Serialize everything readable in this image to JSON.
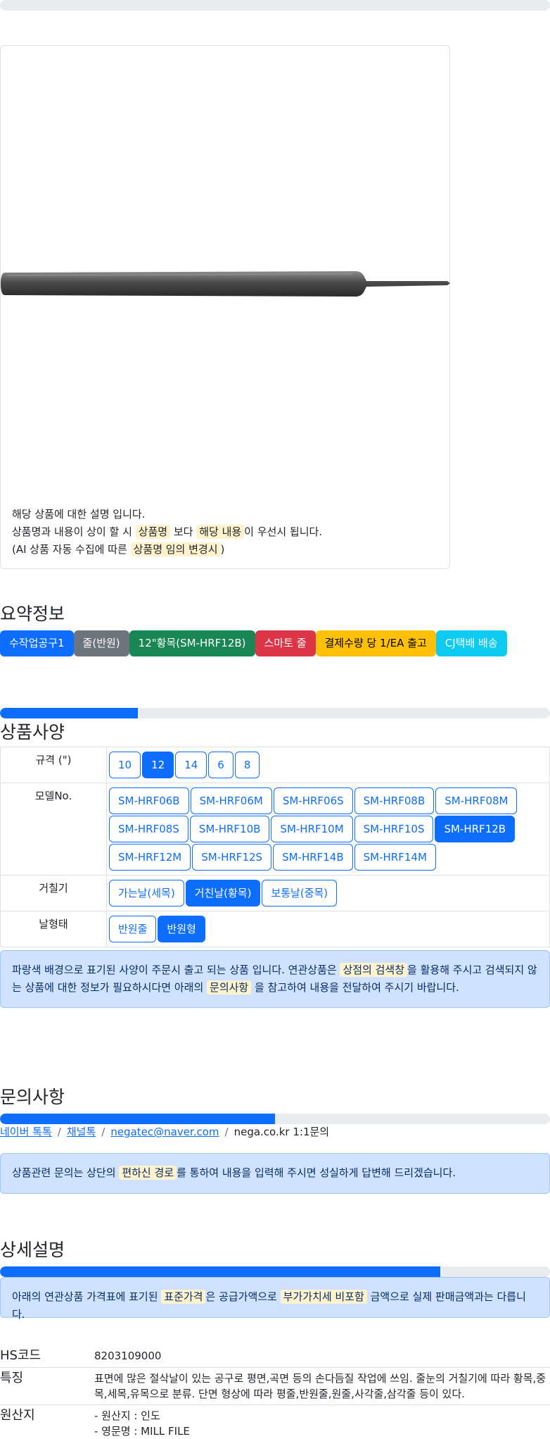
{
  "product": {
    "notice_line1": "해당 상품에 대한 설명 입니다.",
    "notice_line2_a": "상품명과 내용이 상이 할 시 ",
    "notice_line2_b": "상품명",
    "notice_line2_c": " 보다 ",
    "notice_line2_d": "해당 내용",
    "notice_line2_e": "이 우선시 됩니다.",
    "notice_line3_a": "(AI 상품 자동 수집에 따른 ",
    "notice_line3_b": "상품명 임의 변경시",
    "notice_line3_c": ")"
  },
  "summary": {
    "title": "요약정보",
    "badges": [
      {
        "label": "수작업공구1",
        "color": "#0d6efd"
      },
      {
        "label": "줄(반원)",
        "color": "#6c757d"
      },
      {
        "label": "12\"황목(SM-HRF12B)",
        "color": "#198754"
      },
      {
        "label": "스마토 줄",
        "color": "#dc3545"
      },
      {
        "label": "결제수량 당 1/EA 출고",
        "color": "#ffc107"
      },
      {
        "label": "CJ택배 배송",
        "color": "#0dcaf0"
      }
    ]
  },
  "spec": {
    "progress": 0.25,
    "title": "상품사양",
    "rows": [
      {
        "label": "규격 (\")",
        "options": [
          "10",
          "12",
          "14",
          "6",
          "8"
        ],
        "selected": 1
      },
      {
        "label": "모델No.",
        "options": [
          "SM-HRF06B",
          "SM-HRF06M",
          "SM-HRF06S",
          "SM-HRF08B",
          "SM-HRF08M",
          "SM-HRF08S",
          "SM-HRF10B",
          "SM-HRF10M",
          "SM-HRF10S",
          "SM-HRF12B",
          "SM-HRF12M",
          "SM-HRF12S",
          "SM-HRF14B",
          "SM-HRF14M"
        ],
        "selected": 9
      },
      {
        "label": "거칠기",
        "options": [
          "가는날(세목)",
          "거친날(황목)",
          "보통날(중목)"
        ],
        "selected": 1
      },
      {
        "label": "날형태",
        "options": [
          "반원줄",
          "반원형"
        ],
        "selected": 1
      }
    ],
    "notice_a": "파랑색 배경으로 표기된 사양이 주문시 출고 되는 상품 입니다. 연관상품은 ",
    "notice_b": "상점의 검색창",
    "notice_c": "을 활용해 주시고 검색되지 않는 상품에 대한 정보가 필요하시다면 아래의 ",
    "notice_d": "문의사항",
    "notice_e": " 을 참고하여 내용을 전달하여 주시기 바랍니다."
  },
  "inquiry": {
    "title": "문의사항",
    "progress": 0.5,
    "links": [
      "네이버 톡톡",
      "채널톡",
      "negatec@naver.com"
    ],
    "plain": "nega.co.kr 1:1문의",
    "sep": "/",
    "notice_a": "상품관련 문의는 상단의 ",
    "notice_b": "편하신 경로",
    "notice_c": "를 통하여 내용을 입력해 주시면 성실하게 답변해 드리겠습니다."
  },
  "detail": {
    "title": "상세설명",
    "progress": 0.8,
    "notice_a": "아래의 연관상품 가격표에 표기된 ",
    "notice_b": "표준가격",
    "notice_c": "은 공급가액으로 ",
    "notice_d": "부가가치세 비포함",
    "notice_e": " 금액으로 실제 판매금액과는 다릅니다.",
    "rows": [
      {
        "key": "HS코드",
        "value": "8203109000"
      },
      {
        "key": "특징",
        "value": "표면에 많은 절삭날이 있는 공구로 평면,곡면 등의 손다듬질 작업에 쓰임. 줄눈의 거칠기에 따라 황목,중목,세목,유목으로 분류. 단면 형상에 따라 평줄,반원줄,원줄,사각줄,삼각줄 등이 있다."
      },
      {
        "key": "원산지",
        "value": "- 원산지 : 인도",
        "value2": "- 영문명 : MILL FILE"
      }
    ]
  }
}
